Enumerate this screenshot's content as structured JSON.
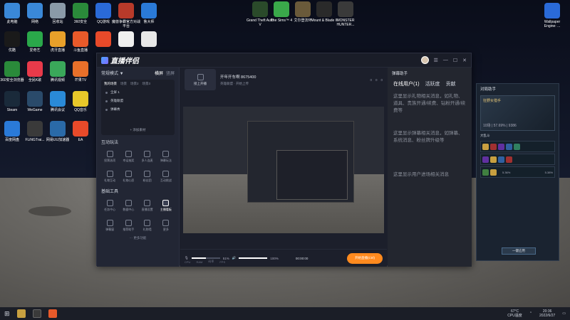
{
  "desktop": {
    "icons_row1": [
      {
        "label": "此电脑",
        "color": "#3a88d8"
      },
      {
        "label": "网络",
        "color": "#3a88d8"
      },
      {
        "label": "回收站",
        "color": "#8a9aa8"
      },
      {
        "label": "360安全",
        "color": "#2a8a3a"
      },
      {
        "label": "QQ游戏",
        "color": "#2a6ad8"
      },
      {
        "label": "魔兽争霸官方对战平台",
        "color": "#b83a2a"
      },
      {
        "label": "鲁大师",
        "color": "#2a7ad8"
      }
    ],
    "icons_row2": [
      {
        "label": "优酷",
        "color": "#1a1a1a"
      },
      {
        "label": "爱奇艺",
        "color": "#2aa84a"
      },
      {
        "label": "虎牙直播",
        "color": "#e8a02a"
      },
      {
        "label": "斗鱼直播",
        "color": "#e85a2a"
      },
      {
        "label": "",
        "color": "#e84a2a"
      },
      {
        "label": "",
        "color": "#f0f0f0"
      },
      {
        "label": "",
        "color": "#e8e8e8"
      }
    ],
    "icons_row3": [
      {
        "label": "360安全浏览器",
        "color": "#2a8a3a"
      },
      {
        "label": "全民K歌",
        "color": "#e83a4a"
      },
      {
        "label": "腾讯视频",
        "color": "#3aa85a"
      },
      {
        "label": "芒果TV",
        "color": "#e8702a"
      }
    ],
    "icons_row4": [
      {
        "label": "Steam",
        "color": "#1a2a3a"
      },
      {
        "label": "WeGame",
        "color": "#2a4a6a"
      },
      {
        "label": "腾讯会议",
        "color": "#2a8ad8"
      },
      {
        "label": "QQ音乐",
        "color": "#e8c82a"
      }
    ],
    "icons_row5": [
      {
        "label": "百度网盘",
        "color": "#2a7ad8"
      },
      {
        "label": "FLiNGTrai...",
        "color": "#3a3a3a"
      },
      {
        "label": "网易UU加速器",
        "color": "#2a6aa8"
      },
      {
        "label": "EA",
        "color": "#e84a2a"
      }
    ],
    "top_games": [
      {
        "label": "Grand Theft Auto V",
        "color": "#2a4a2a"
      },
      {
        "label": "The Sims™ 4",
        "color": "#3aa84a"
      },
      {
        "label": "艾尔登法环",
        "color": "#6a5a3a"
      },
      {
        "label": "Mount & Blade II",
        "color": "#2a2a2a"
      },
      {
        "label": "MONSTER HUNTER...",
        "color": "#3a3a3a"
      }
    ],
    "top_right_icon": {
      "label": "Wallpaper Engine: ...",
      "color": "#2a6ad8"
    }
  },
  "app": {
    "title": "直播伴侣",
    "left": {
      "mode": "常规模式 ▼",
      "link1": "横屏",
      "link2": "竖屏",
      "scene_tabs": [
        "我的场景",
        "场景",
        "场景2",
        "场景3"
      ],
      "scenes": [
        "全屏 1",
        "英雄联盟",
        "弹幕秀"
      ],
      "add_source": "+ 添加素材",
      "interact_title": "互动玩法",
      "interact": [
        "投票选项",
        "幸运抽奖",
        "多人连麦",
        "弹幕玩法",
        "礼物互动",
        "礼物心愿",
        "粉丝团",
        "互动挑战"
      ],
      "tools_title": "基础工具",
      "tools": [
        "任务中心",
        "数据中心",
        "直播设置",
        "主播看板",
        "弹幕窗",
        "推荐助手",
        "礼物墙",
        "更多"
      ],
      "more": "··· 更多功能"
    },
    "center": {
      "stream_btn": "接上开播",
      "room": "开年开车啊 8675400",
      "room_sub": "英雄联盟 · 开始上传",
      "counters": [
        "0",
        "0",
        "0"
      ],
      "vol1": "51%",
      "vol2": "100%",
      "timer": "00:00:00",
      "start": "开始直播(Ctrl)",
      "status": [
        "CPU",
        "RAM",
        "码率",
        "FPS"
      ]
    },
    "right": {
      "title": "弹幕助手",
      "tabs": [
        "在线用户(1)",
        "活跃度",
        "贡献"
      ],
      "text1": "这里显示礼物相关消息，如礼物、道具、贵族开通/续费、钻粉开通/续费等",
      "text2": "这里显示弹幕相关消息，如弹幕、系统消息、粉丝牌升级等",
      "text3": "这里显示用户进场相关消息"
    }
  },
  "lol_panel": {
    "title": "对局助手",
    "champ": "狂野女猎手",
    "stats": "10场 | 57.69% | 9386",
    "tag1": "大乱斗",
    "btn": "一键应用",
    "pct1": "5.36%",
    "pct2": "5.38%"
  },
  "taskbar": {
    "temp": "67°C",
    "cpu": "CPU温度",
    "time": "20:36",
    "date": "2022/6/27"
  }
}
